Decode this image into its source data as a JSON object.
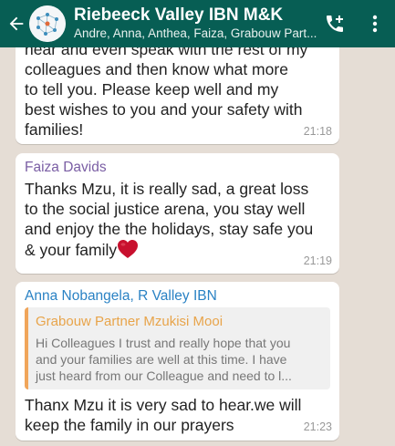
{
  "header": {
    "title": "Riebeeck Valley IBN M&K",
    "subtitle": "Andre, Anna, Anthea, Faiza, Grabouw Part...",
    "back_icon": "arrow-left-icon",
    "add_call_icon": "phone-plus-icon",
    "menu_icon": "more-vert-icon",
    "bar_color": "#075e54"
  },
  "messages": [
    {
      "text_lines": [
        "colleagues and then know what more",
        "to tell you. Please keep well and my",
        "best wishes to you and your safety with",
        "families!"
      ],
      "partial_top_line": "hear and even speak with the rest of my",
      "time": "21:18"
    },
    {
      "sender": "Faiza Davids",
      "sender_color": "#7a5ea4",
      "text_lines": [
        "Thanks Mzu, it is really sad, a great loss",
        "to the social justice arena, you stay well",
        "and enjoy the the holidays, stay safe you",
        "& your family"
      ],
      "emoji_icon": "red-heart-icon",
      "time": "21:19"
    },
    {
      "sender": "Anna Nobangela, R Valley IBN",
      "sender_color": "#2a82c4",
      "quote": {
        "sender": "Grabouw Partner Mzukisi Mooi",
        "text_lines": [
          "Hi Colleagues I trust and really hope that you",
          "and your families are well at this time. I have",
          "just heard from our Colleague and need to l..."
        ]
      },
      "text_lines": [
        "Thanx Mzu it is very sad to hear.we will",
        "keep the family in our prayers"
      ],
      "time": "21:23"
    }
  ]
}
